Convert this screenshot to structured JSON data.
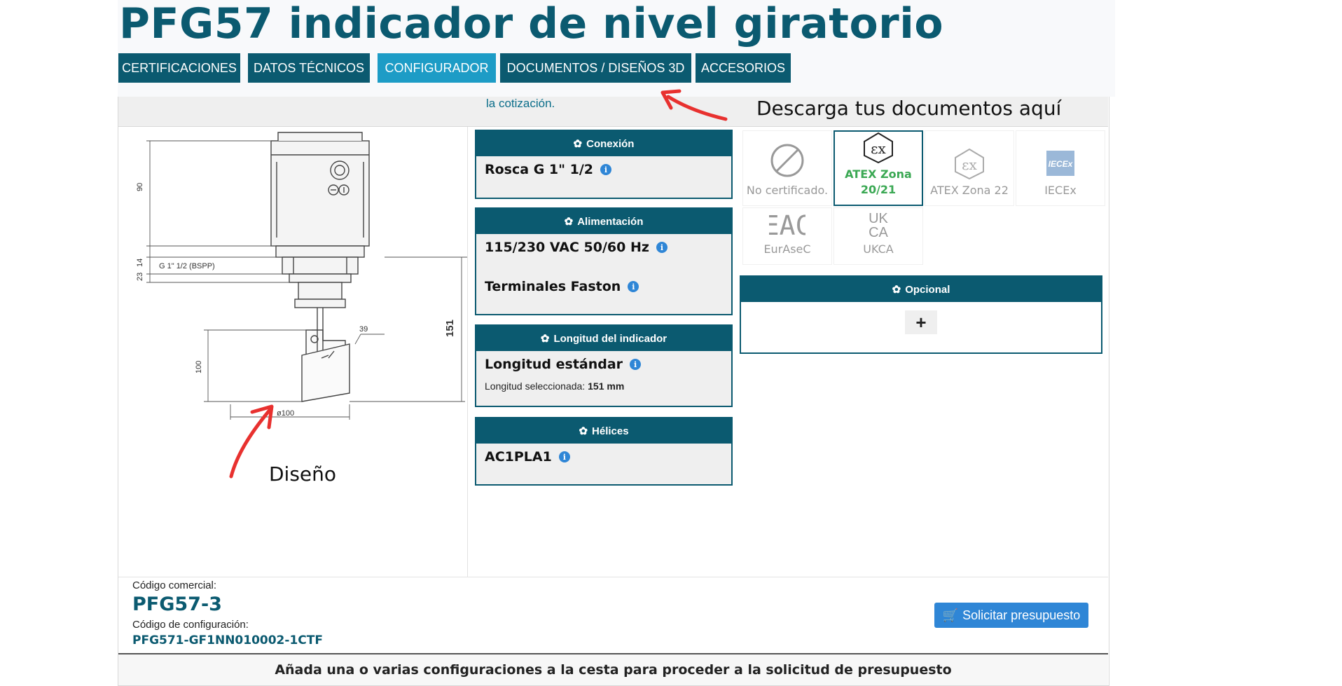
{
  "page": {
    "title": "PFG57 indicador de nivel giratorio",
    "tabs": [
      {
        "label": "CERTIFICACIONES",
        "active": false
      },
      {
        "label": "DATOS TÉCNICOS",
        "active": false
      },
      {
        "label": "CONFIGURADOR",
        "active": true
      },
      {
        "label": "DOCUMENTOS / DISEÑOS 3D",
        "active": false
      },
      {
        "label": "ACCESORIOS",
        "active": false
      }
    ],
    "cotizacion_text": "la cotización."
  },
  "drawing": {
    "dims": {
      "d90": "90",
      "d14": "14",
      "d23": "23",
      "thread": "G 1\" 1/2 (BSPP)",
      "d151": "151",
      "d39": "39",
      "d100": "100",
      "dia100": "ø100"
    }
  },
  "config": {
    "conexion": {
      "header": "Conexión",
      "value": "Rosca G 1\" 1/2"
    },
    "alimentacion": {
      "header": "Alimentación",
      "value1": "115/230 VAC 50/60 Hz",
      "value2": "Terminales Faston"
    },
    "longitud": {
      "header": "Longitud del indicador",
      "value": "Longitud estándar",
      "selected_label": "Longitud seleccionada:",
      "selected_value": "151 mm"
    },
    "helices": {
      "header": "Hélices",
      "value": "AC1PLA1"
    }
  },
  "certifications": [
    {
      "label": "No certificado.",
      "icon": "no-cert-icon",
      "selected": false
    },
    {
      "label": "ATEX Zona 20/21",
      "icon": "ex-icon",
      "selected": true
    },
    {
      "label": "ATEX Zona 22",
      "icon": "ex-icon",
      "selected": false
    },
    {
      "label": "IECEx",
      "icon": "iecex-icon",
      "selected": false
    },
    {
      "label": "EurAseC",
      "icon": "eac-icon",
      "selected": false
    },
    {
      "label": "UKCA",
      "icon": "ukca-icon",
      "selected": false
    }
  ],
  "icon_text": {
    "iecex": "IECEx",
    "eac": "EAC",
    "uk": "UK",
    "ca": "CA"
  },
  "opcional": {
    "header": "Opcional",
    "plus": "+"
  },
  "footer": {
    "commercial_code_label": "Código comercial:",
    "commercial_code": "PFG57-3",
    "config_code_label": "Código de configuración:",
    "config_code": "PFG571-GF1NN010002-1CTF",
    "quote_button": "Solicitar presupuesto",
    "bottom_message": "Añada una o varias configuraciones a la cesta para proceder a la solicitud de presupuesto"
  },
  "annotations": {
    "docs_note": "Descarga tus documentos aquí",
    "design_note": "Diseño"
  },
  "colors": {
    "brand": "#0b5a70",
    "active_tab": "#1d9cc6",
    "button": "#2f86d6",
    "arrow": "#e8312f",
    "selected_cert": "#3aa853"
  }
}
